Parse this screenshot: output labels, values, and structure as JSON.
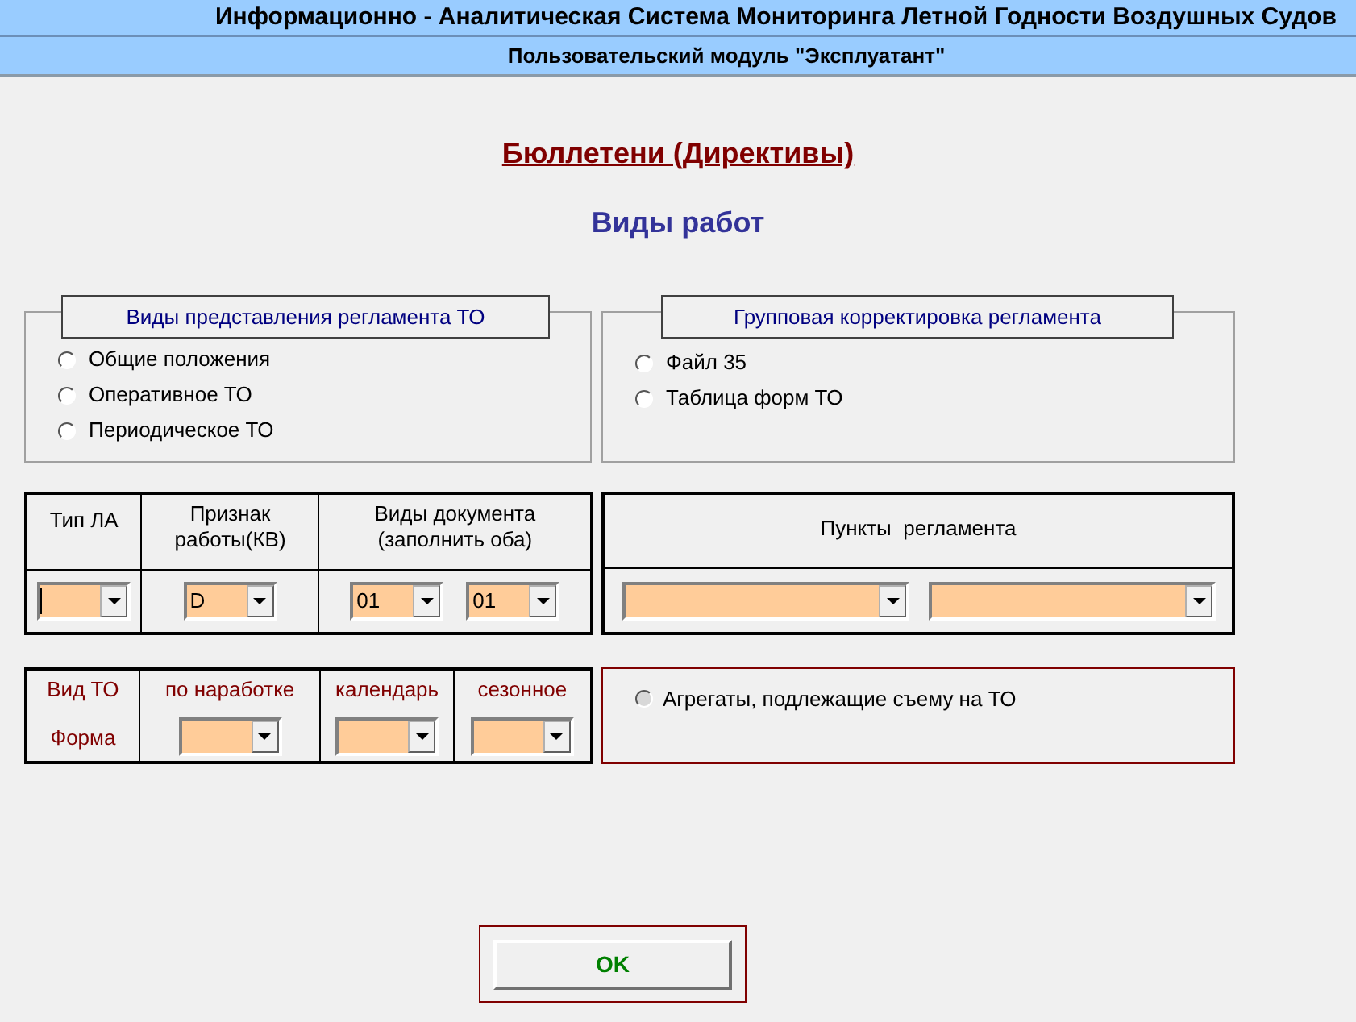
{
  "header": {
    "title": "Информационно - Аналитическая Система Мониторинга Летной Годности Воздушных Судов",
    "subtitle": "Пользовательский модуль \"Эксплуатант\""
  },
  "section_title": "Бюллетени (Директивы)",
  "page_title": "Виды работ",
  "presentation_group": {
    "legend": "Виды представления регламента ТО",
    "options": [
      {
        "label": "Общие положения",
        "selected": false
      },
      {
        "label": "Оперативное ТО",
        "selected": false
      },
      {
        "label": "Периодическое ТО",
        "selected": false
      }
    ]
  },
  "correction_group": {
    "legend": "Групповая корректировка регламента",
    "options": [
      {
        "label": "Файл 35",
        "selected": false
      },
      {
        "label": "Таблица форм ТО",
        "selected": false
      }
    ]
  },
  "filters_table": {
    "columns": [
      {
        "header": "Тип ЛА",
        "selects": [
          {
            "focused": true
          }
        ]
      },
      {
        "header": "Признак работы(КВ)",
        "selects": [
          {
            "value": "D",
            "focused": false
          }
        ]
      },
      {
        "header": "Виды  документа (заполнить оба)",
        "selects": [
          {
            "value": "01",
            "focused": false
          },
          {
            "value": "01",
            "focused": false
          }
        ]
      }
    ]
  },
  "regulation_points": {
    "header": "Пункты  регламента",
    "selects": [
      {
        "focused": false
      },
      {
        "focused": false
      }
    ]
  },
  "maintenance_table": {
    "row_labels": [
      "Вид ТО",
      "Форма"
    ],
    "columns": [
      {
        "header": "по наработке",
        "select": {
          "focused": false
        }
      },
      {
        "header": "календарь",
        "select": {
          "focused": false
        }
      },
      {
        "header": "сезонное",
        "select": {
          "focused": false
        }
      }
    ]
  },
  "units_option": {
    "label": "Агрегаты, подлежащие съему на ТО",
    "selected": false,
    "disabled": true
  },
  "ok_button": {
    "label": "OK"
  }
}
